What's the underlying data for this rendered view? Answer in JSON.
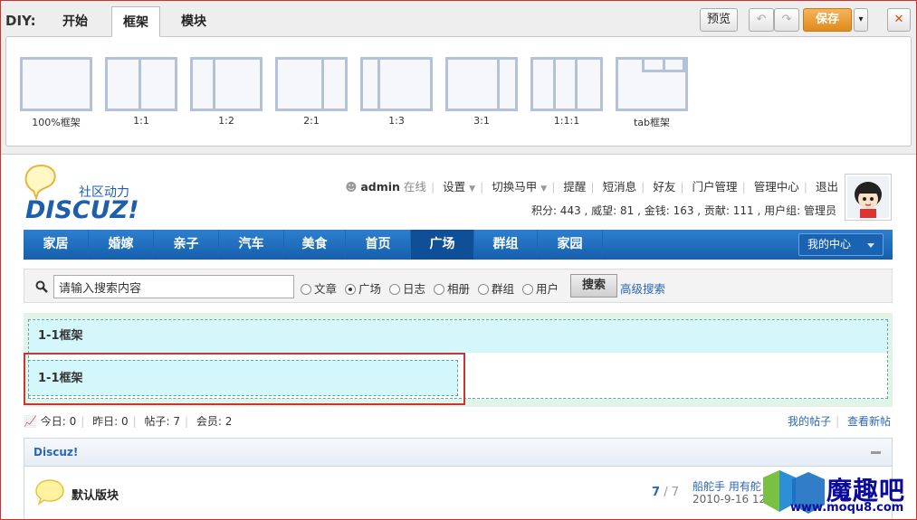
{
  "diy": {
    "label": "DIY:",
    "tabs": [
      {
        "label": "开始",
        "active": false
      },
      {
        "label": "框架",
        "active": true
      },
      {
        "label": "模块",
        "active": false
      }
    ],
    "frames": [
      {
        "label": "100%框架"
      },
      {
        "label": "1:1"
      },
      {
        "label": "1:2"
      },
      {
        "label": "2:1"
      },
      {
        "label": "1:3"
      },
      {
        "label": "3:1"
      },
      {
        "label": "1:1:1"
      },
      {
        "label": "tab框架"
      }
    ],
    "preview_label": "预览",
    "save_label": "保存",
    "close_glyph": "✕",
    "undo_glyph": "↶",
    "redo_glyph": "↷",
    "caret_glyph": "▾",
    "save_color": "#e08b1b"
  },
  "header": {
    "logo_text": "DISCUZ!",
    "logo_subtitle": "社区动力",
    "username": "admin",
    "online_status": "在线",
    "links": [
      "设置",
      "切换马甲",
      "提醒",
      "短消息",
      "好友",
      "门户管理",
      "管理中心",
      "退出"
    ],
    "credits": "积分: 443 , 威望: 81 , 金钱: 163 , 贡献: 111 , 用户组: 管理员"
  },
  "nav": {
    "items": [
      {
        "label": "家居",
        "active": false
      },
      {
        "label": "婚嫁",
        "active": false
      },
      {
        "label": "亲子",
        "active": false
      },
      {
        "label": "汽车",
        "active": false
      },
      {
        "label": "美食",
        "active": false
      },
      {
        "label": "首页",
        "active": false
      },
      {
        "label": "广场",
        "active": true
      },
      {
        "label": "群组",
        "active": false
      },
      {
        "label": "家园",
        "active": false
      }
    ],
    "my_center": "我的中心",
    "color": "#155fae"
  },
  "search": {
    "placeholder": "请输入搜索内容",
    "options": [
      {
        "label": "文章",
        "checked": false
      },
      {
        "label": "广场",
        "checked": true
      },
      {
        "label": "日志",
        "checked": false
      },
      {
        "label": "相册",
        "checked": false
      },
      {
        "label": "群组",
        "checked": false
      },
      {
        "label": "用户",
        "checked": false
      }
    ],
    "button_label": "搜索",
    "advanced_label": "高级搜索"
  },
  "diy_area": {
    "outer_title": "1-1框架",
    "inner_title": "1-1框架"
  },
  "stats": {
    "today": "今日: 0",
    "yesterday": "昨日: 0",
    "posts": "帖子: 7",
    "members": "会员: 2",
    "my_posts": "我的帖子",
    "new_posts": "查看新帖"
  },
  "forum": {
    "category": "Discuz!",
    "name": "默认版块",
    "threads": "7",
    "posts": "/ 7",
    "last_post_title": "船舵手 用有舵",
    "last_post_time": "2010-9-16 12"
  },
  "watermark": {
    "cn": "魔趣吧",
    "url": "www.moqu8.com"
  }
}
